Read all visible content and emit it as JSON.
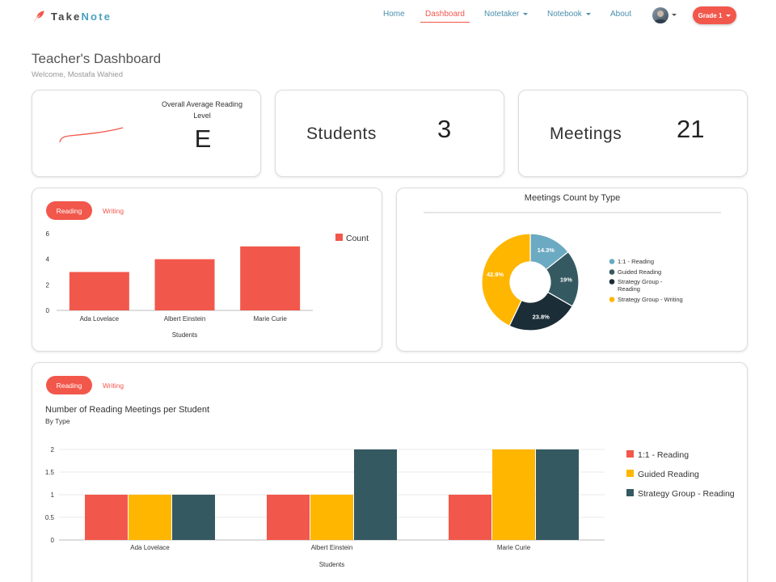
{
  "nav": {
    "brand_take": "Take",
    "brand_note": "Note",
    "items": [
      {
        "label": "Home",
        "active": false
      },
      {
        "label": "Dashboard",
        "active": true
      },
      {
        "label": "Notetaker",
        "active": false
      },
      {
        "label": "Notebook",
        "active": false
      },
      {
        "label": "About",
        "active": false
      }
    ],
    "grade_button": "Grade 1"
  },
  "header": {
    "title": "Teacher's Dashboard",
    "welcome": "Welcome, Mostafa Wahied"
  },
  "stats": {
    "reading_level_label": "Overall Average Reading Level",
    "reading_level_value": "E",
    "students_label": "Students",
    "students_value": "3",
    "meetings_label": "Meetings",
    "meetings_value": "21"
  },
  "tabs": {
    "reading": "Reading",
    "writing": "Writing"
  },
  "colors": {
    "accent": "#f2574b",
    "teal_dark": "#355961",
    "gold": "#ffb600",
    "light_blue": "#6baac2",
    "navy": "#1b2d36"
  },
  "chart_data": [
    {
      "type": "bar",
      "categories": [
        "Ada Lovelace",
        "Albert Einstein",
        "Marie Curie"
      ],
      "series": [
        {
          "name": "Count",
          "values": [
            3,
            4,
            5
          ],
          "color": "#f2574b"
        }
      ],
      "xlabel": "Students",
      "ylabel": "",
      "ylim": [
        0,
        6
      ],
      "yticks": [
        0,
        2,
        4,
        6
      ],
      "legend": "right"
    },
    {
      "type": "pie",
      "title": "Meetings Count by Type",
      "donut": true,
      "slices": [
        {
          "label": "1:1 - Reading",
          "value": 14.3,
          "text": "14.3%",
          "color": "#6baac2"
        },
        {
          "label": "Guided Reading",
          "value": 19,
          "text": "19%",
          "color": "#355961"
        },
        {
          "label": "Strategy Group - Reading",
          "value": 23.8,
          "text": "23.8%",
          "color": "#1b2d36"
        },
        {
          "label": "Strategy Group - Writing",
          "value": 42.9,
          "text": "42.9%",
          "color": "#ffb600"
        }
      ],
      "legend": "right"
    },
    {
      "type": "bar",
      "title": "Number of Reading Meetings per Student",
      "subtitle": "By Type",
      "categories": [
        "Ada Lovelace",
        "Albert Einstein",
        "Marie Curie"
      ],
      "series": [
        {
          "name": "1:1 - Reading",
          "values": [
            1,
            1,
            1
          ],
          "color": "#f2574b"
        },
        {
          "name": "Guided Reading",
          "values": [
            1,
            1,
            2
          ],
          "color": "#ffb600"
        },
        {
          "name": "Strategy Group - Reading",
          "values": [
            1,
            2,
            2
          ],
          "color": "#355961"
        }
      ],
      "xlabel": "Students",
      "ylim": [
        0,
        2
      ],
      "yticks": [
        "0",
        "0.5",
        "1",
        "1.5",
        "2"
      ],
      "legend": "right"
    }
  ]
}
